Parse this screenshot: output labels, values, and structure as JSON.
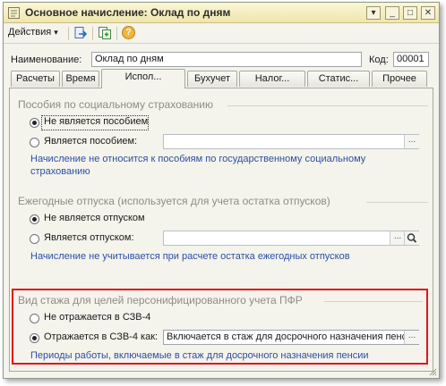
{
  "window": {
    "title": "Основное начисление: Оклад по дням"
  },
  "titlebar_buttons": {
    "menu": "▾",
    "minimize": "_",
    "maximize": "□",
    "close": "✕"
  },
  "toolbar": {
    "actions_label": "Действия",
    "actions_arrow": "▾",
    "help_label": "?"
  },
  "header": {
    "name_label": "Наименование:",
    "name_value": "Оклад по дням",
    "code_label": "Код:",
    "code_value": "00001"
  },
  "tabs": [
    {
      "label": "Расчеты"
    },
    {
      "label": "Время"
    },
    {
      "label": "Испол..."
    },
    {
      "label": "Бухучет"
    },
    {
      "label": "Налог..."
    },
    {
      "label": "Статис..."
    },
    {
      "label": "Прочее"
    }
  ],
  "benefits": {
    "title": "Пособия по социальному страхованию",
    "option1": "Не является пособием",
    "option2": "Является пособием:",
    "input_value": "",
    "browse_label": "...",
    "info": "Начисление не относится к пособиям по государственному социальному страхованию"
  },
  "vacations": {
    "title": "Ежегодные отпуска (используется для учета остатка отпусков)",
    "option1": "Не является отпуском",
    "option2": "Является отпуском:",
    "input_value": "",
    "browse_label": "...",
    "info": "Начисление не учитывается при расчете остатка ежегодных отпусков"
  },
  "seniority": {
    "title": "Вид стажа для целей персонифицированного учета ПФР",
    "option1": "Не отражается в СЗВ-4",
    "option2": "Отражается в СЗВ-4 как:",
    "select_value": "Включается в стаж для досрочного назначения пенс",
    "browse_label": "...",
    "info": "Периоды работы, включаемые в стаж для досрочного назначения пенсии"
  },
  "colors": {
    "accent_blue": "#2b4fa3",
    "highlight_red": "#e2161c",
    "title_bg": "#efe6ad"
  }
}
